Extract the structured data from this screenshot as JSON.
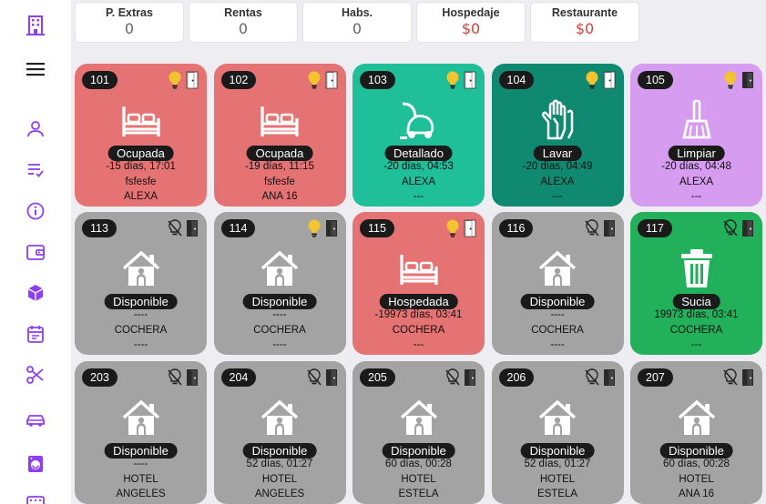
{
  "stats": [
    {
      "label": "P. Extras",
      "value": "0"
    },
    {
      "label": "Rentas",
      "value": "0"
    },
    {
      "label": "Habs.",
      "value": "0"
    },
    {
      "label": "Hospedaje",
      "value": "$0"
    },
    {
      "label": "Restaurante",
      "value": "$0"
    }
  ],
  "sidebar": {
    "accent": "#8e3ff0",
    "icons": [
      "building-icon",
      "menu-icon",
      "user-icon",
      "checklist-icon",
      "info-icon",
      "wallet-icon",
      "box-icon",
      "calendar-icon",
      "scissors-icon",
      "car-icon",
      "washer-icon",
      "keyboard-icon"
    ]
  },
  "rooms": [
    {
      "number": "101",
      "status": "Ocupada",
      "line1": "-15 días, 17:01",
      "line2": "fsfesfe",
      "line3": "ALEXA",
      "color": "#e57373",
      "icon": "bed-icon",
      "bulb": "on",
      "door": "white"
    },
    {
      "number": "102",
      "status": "Ocupada",
      "line1": "-19 días, 11:15",
      "line2": "fsfesfe",
      "line3": "ANA 16",
      "color": "#e57373",
      "icon": "bed-icon",
      "bulb": "on",
      "door": "white"
    },
    {
      "number": "103",
      "status": "Detallado",
      "line1": "-20 días, 04:53",
      "line2": "ALEXA",
      "line3": "---",
      "color": "#1fbf9a",
      "icon": "vacuum-icon",
      "bulb": "on",
      "door": "white"
    },
    {
      "number": "104",
      "status": "Lavar",
      "line1": "-20 días, 04:49",
      "line2": "ALEXA",
      "line3": "---",
      "color": "#0f8a70",
      "icon": "gloves-icon",
      "bulb": "on",
      "door": "white"
    },
    {
      "number": "105",
      "status": "Limpiar",
      "line1": "-20 días, 04:48",
      "line2": "ALEXA",
      "line3": "---",
      "color": "#d59cf0",
      "icon": "broom-icon",
      "bulb": "on",
      "door": "dark"
    },
    {
      "number": "113",
      "status": "Disponible",
      "line1": "----",
      "line2": "COCHERA",
      "line3": "----",
      "color": "#a3a3a3",
      "icon": "house-icon",
      "bulb": "off",
      "door": "dark"
    },
    {
      "number": "114",
      "status": "Disponible",
      "line1": "----",
      "line2": "COCHERA",
      "line3": "----",
      "color": "#a3a3a3",
      "icon": "house-icon",
      "bulb": "on",
      "door": "dark"
    },
    {
      "number": "115",
      "status": "Hospedada",
      "line1": "-19973 días, 03:41",
      "line2": "COCHERA",
      "line3": "---",
      "color": "#e57373",
      "icon": "bed-icon",
      "bulb": "on",
      "door": "white"
    },
    {
      "number": "116",
      "status": "Disponible",
      "line1": "----",
      "line2": "COCHERA",
      "line3": "----",
      "color": "#a3a3a3",
      "icon": "house-icon",
      "bulb": "off",
      "door": "dark"
    },
    {
      "number": "117",
      "status": "Sucia",
      "line1": "19973 días, 03:41",
      "line2": "COCHERA",
      "line3": "---",
      "color": "#22b15a",
      "icon": "trash-icon",
      "bulb": "off",
      "door": "dark"
    },
    {
      "number": "203",
      "status": "Disponible",
      "line1": "----",
      "line2": "HOTEL",
      "line3": "ANGELES",
      "color": "#a3a3a3",
      "icon": "house-icon",
      "bulb": "off",
      "door": "dark"
    },
    {
      "number": "204",
      "status": "Disponible",
      "line1": "52 días, 01:27",
      "line2": "HOTEL",
      "line3": "ANGELES",
      "color": "#a3a3a3",
      "icon": "house-icon",
      "bulb": "off",
      "door": "dark"
    },
    {
      "number": "205",
      "status": "Disponible",
      "line1": "60 días, 00:28",
      "line2": "HOTEL",
      "line3": "ESTELA",
      "color": "#a3a3a3",
      "icon": "house-icon",
      "bulb": "off",
      "door": "dark"
    },
    {
      "number": "206",
      "status": "Disponible",
      "line1": "52 días, 01:27",
      "line2": "HOTEL",
      "line3": "ESTELA",
      "color": "#a3a3a3",
      "icon": "house-icon",
      "bulb": "off",
      "door": "dark"
    },
    {
      "number": "207",
      "status": "Disponible",
      "line1": "60 días, 00:28",
      "line2": "HOTEL",
      "line3": "ANA 16",
      "color": "#a3a3a3",
      "icon": "house-icon",
      "bulb": "off",
      "door": "dark"
    }
  ]
}
